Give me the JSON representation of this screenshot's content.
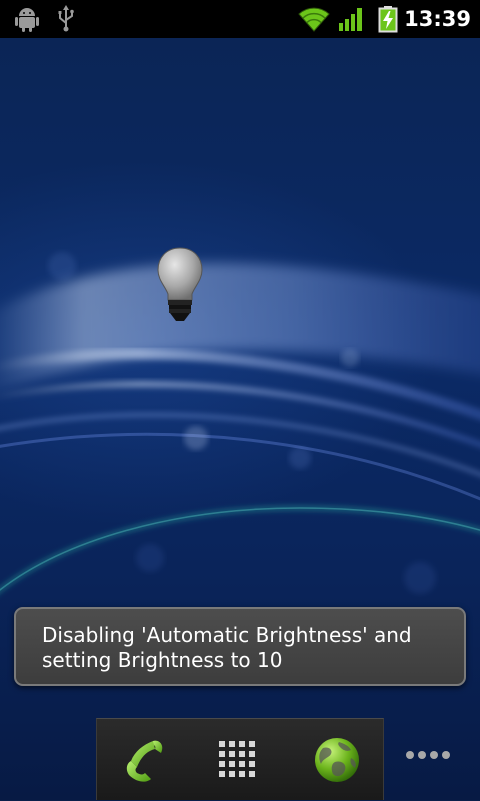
{
  "status_bar": {
    "time": "13:39",
    "icons": [
      "android-debug-icon",
      "usb-icon",
      "wifi-icon",
      "signal-icon",
      "battery-charging-icon"
    ],
    "colors": {
      "wifi": "#6cc51a",
      "signal": "#6cc51a",
      "battery": "#6cc51a"
    }
  },
  "widget": {
    "icon": "lightbulb-icon"
  },
  "toast": {
    "line1": "Disabling 'Automatic Brightness' and",
    "line2": "setting Brightness to 10"
  },
  "dock": {
    "items": [
      {
        "name": "phone-icon"
      },
      {
        "name": "app-drawer-icon"
      },
      {
        "name": "browser-globe-icon"
      }
    ],
    "more": "more-dots-icon"
  },
  "colors": {
    "wallpaper": "#0a2558",
    "toast_bg": "#444444",
    "accent_green": "#6cc51a"
  }
}
